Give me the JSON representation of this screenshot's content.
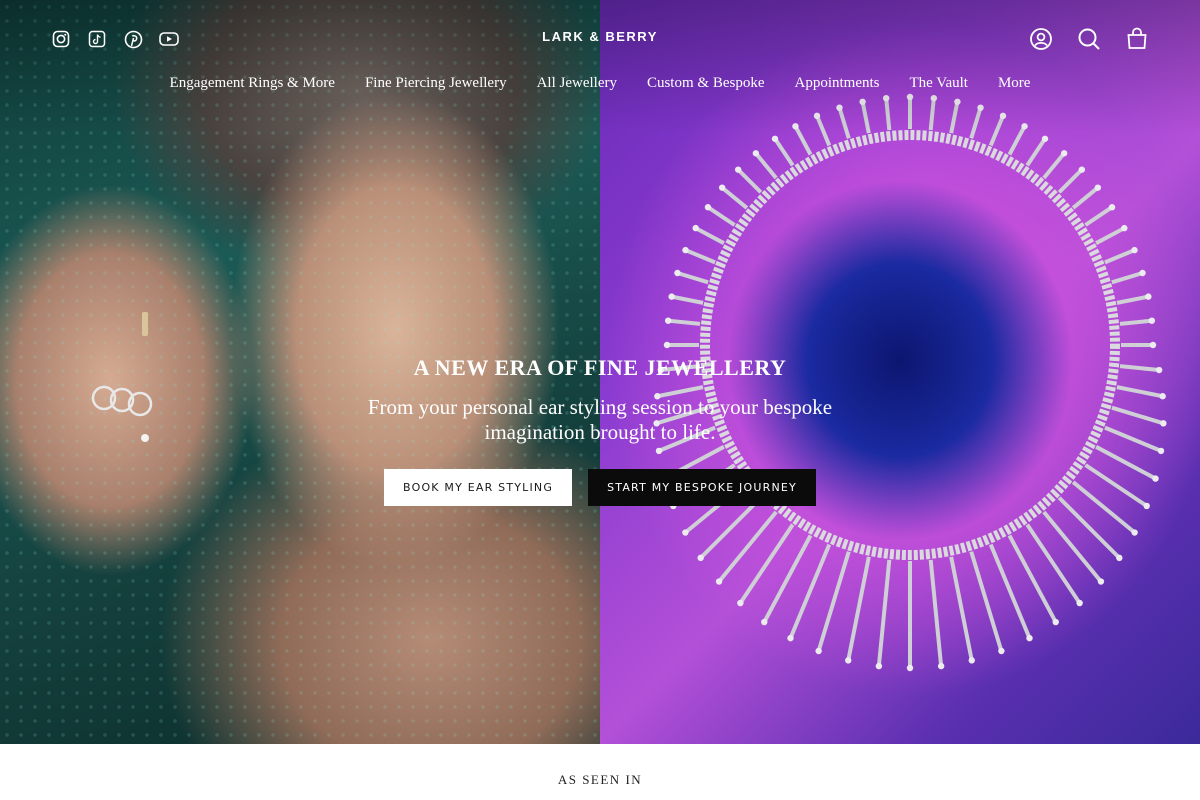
{
  "brand": {
    "logo_text": "LARK & BERRY"
  },
  "header": {
    "social_icons": [
      "instagram-icon",
      "tiktok-icon",
      "pinterest-icon",
      "youtube-icon"
    ],
    "utility_icons": [
      "account-icon",
      "search-icon",
      "cart-icon"
    ]
  },
  "nav": {
    "items": [
      {
        "label": "Engagement Rings & More"
      },
      {
        "label": "Fine Piercing Jewellery"
      },
      {
        "label": "All Jewellery"
      },
      {
        "label": "Custom & Bespoke"
      },
      {
        "label": "Appointments"
      },
      {
        "label": "The Vault"
      },
      {
        "label": "More"
      }
    ]
  },
  "hero": {
    "title": "A NEW ERA OF FINE JEWELLERY",
    "subtitle": "From your personal ear styling session to your bespoke imagination brought to life.",
    "primary_button": "BOOK MY EAR STYLING",
    "secondary_button": "START MY BESPOKE JOURNEY"
  },
  "section": {
    "as_seen_in": "AS SEEN IN"
  },
  "colors": {
    "text_light": "#ffffff",
    "button_dark": "#0b0b0b",
    "left_panel": "#1c5a55",
    "right_panel": "#8a3bd0"
  }
}
